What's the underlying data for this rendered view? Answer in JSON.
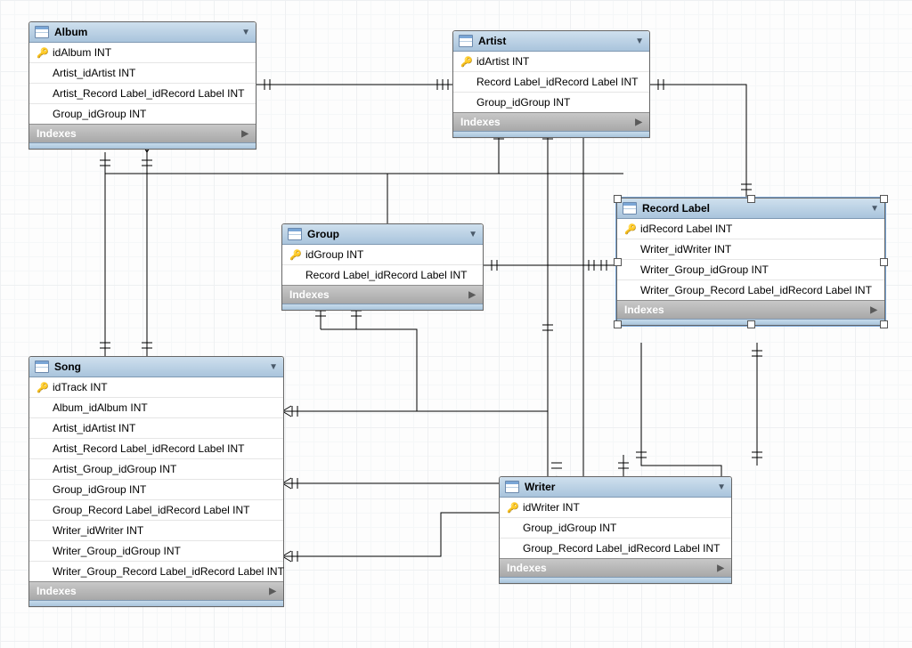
{
  "labels": {
    "indexes": "Indexes"
  },
  "entities": {
    "album": {
      "name": "Album",
      "cols": [
        "idAlbum INT",
        "Artist_idArtist INT",
        "Artist_Record Label_idRecord Label INT",
        "Group_idGroup INT"
      ]
    },
    "artist": {
      "name": "Artist",
      "cols": [
        "idArtist INT",
        "Record Label_idRecord Label INT",
        "Group_idGroup INT"
      ]
    },
    "group": {
      "name": "Group",
      "cols": [
        "idGroup INT",
        "Record Label_idRecord Label INT"
      ]
    },
    "record_label": {
      "name": "Record Label",
      "selected": true,
      "cols": [
        "idRecord Label INT",
        "Writer_idWriter INT",
        "Writer_Group_idGroup INT",
        "Writer_Group_Record Label_idRecord Label INT"
      ]
    },
    "song": {
      "name": "Song",
      "cols": [
        "idTrack INT",
        "Album_idAlbum INT",
        "Artist_idArtist INT",
        "Artist_Record Label_idRecord Label INT",
        "Artist_Group_idGroup INT",
        "Group_idGroup INT",
        "Group_Record Label_idRecord Label INT",
        "Writer_idWriter INT",
        "Writer_Group_idGroup INT",
        "Writer_Group_Record Label_idRecord Label INT"
      ]
    },
    "writer": {
      "name": "Writer",
      "cols": [
        "idWriter INT",
        "Group_idGroup INT",
        "Group_Record Label_idRecord Label INT"
      ]
    }
  },
  "relationships": [
    {
      "from": "album",
      "to": "artist",
      "type": "many-to-one"
    },
    {
      "from": "artist",
      "to": "record_label",
      "type": "many-to-one"
    },
    {
      "from": "artist",
      "to": "group",
      "type": "many-to-one"
    },
    {
      "from": "album",
      "to": "group",
      "type": "many-to-one"
    },
    {
      "from": "album",
      "to": "song",
      "type": "one-to-many"
    },
    {
      "from": "group",
      "to": "record_label",
      "type": "many-to-one"
    },
    {
      "from": "song",
      "to": "artist",
      "type": "many-to-one"
    },
    {
      "from": "song",
      "to": "group",
      "type": "many-to-one"
    },
    {
      "from": "song",
      "to": "writer",
      "type": "many-to-one"
    },
    {
      "from": "writer",
      "to": "group",
      "type": "many-to-one"
    },
    {
      "from": "writer",
      "to": "record_label",
      "type": "one-to-many"
    }
  ]
}
